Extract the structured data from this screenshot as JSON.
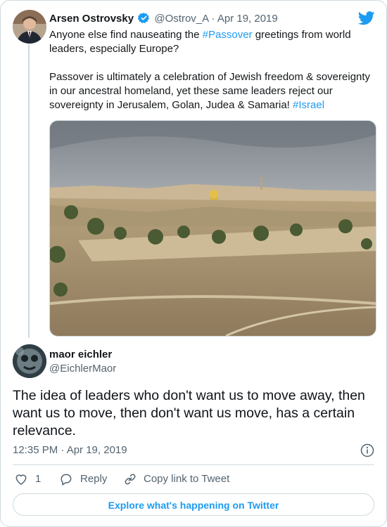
{
  "parent_tweet": {
    "author_name": "Arsen Ostrovsky",
    "handle": "@Ostrov_A",
    "separator": "·",
    "date": "Apr 19, 2019",
    "text_line1_before": "Anyone else find nauseating the ",
    "hashtag1": "#Passover",
    "text_line1_after": " greetings from world leaders, especially Europe?",
    "text_para2_before": "Passover is ultimately a celebration of Jewish freedom & sovereignty in our ancestral homeland, yet these same leaders reject our sovereignty in Jerusalem, Golan, Judea & Samaria! ",
    "hashtag2": "#Israel",
    "verified_icon": "verified-badge",
    "photo_description_icon": "jerusalem-photo"
  },
  "main_tweet": {
    "author_name": "maor eichler",
    "handle": "@EichlerMaor",
    "text": "The idea of leaders who don't want us to move away, then want us to move, then don't want us move, has a certain relevance.",
    "timestamp": "12:35 PM · Apr 19, 2019"
  },
  "actions": {
    "like_count": "1",
    "reply_label": "Reply",
    "copy_link_label": "Copy link to Tweet"
  },
  "footer": {
    "explore_label": "Explore what's happening on Twitter"
  },
  "colors": {
    "accent": "#1d9bf0",
    "text": "#14171a",
    "muted": "#536471",
    "border": "#cfd9de"
  }
}
